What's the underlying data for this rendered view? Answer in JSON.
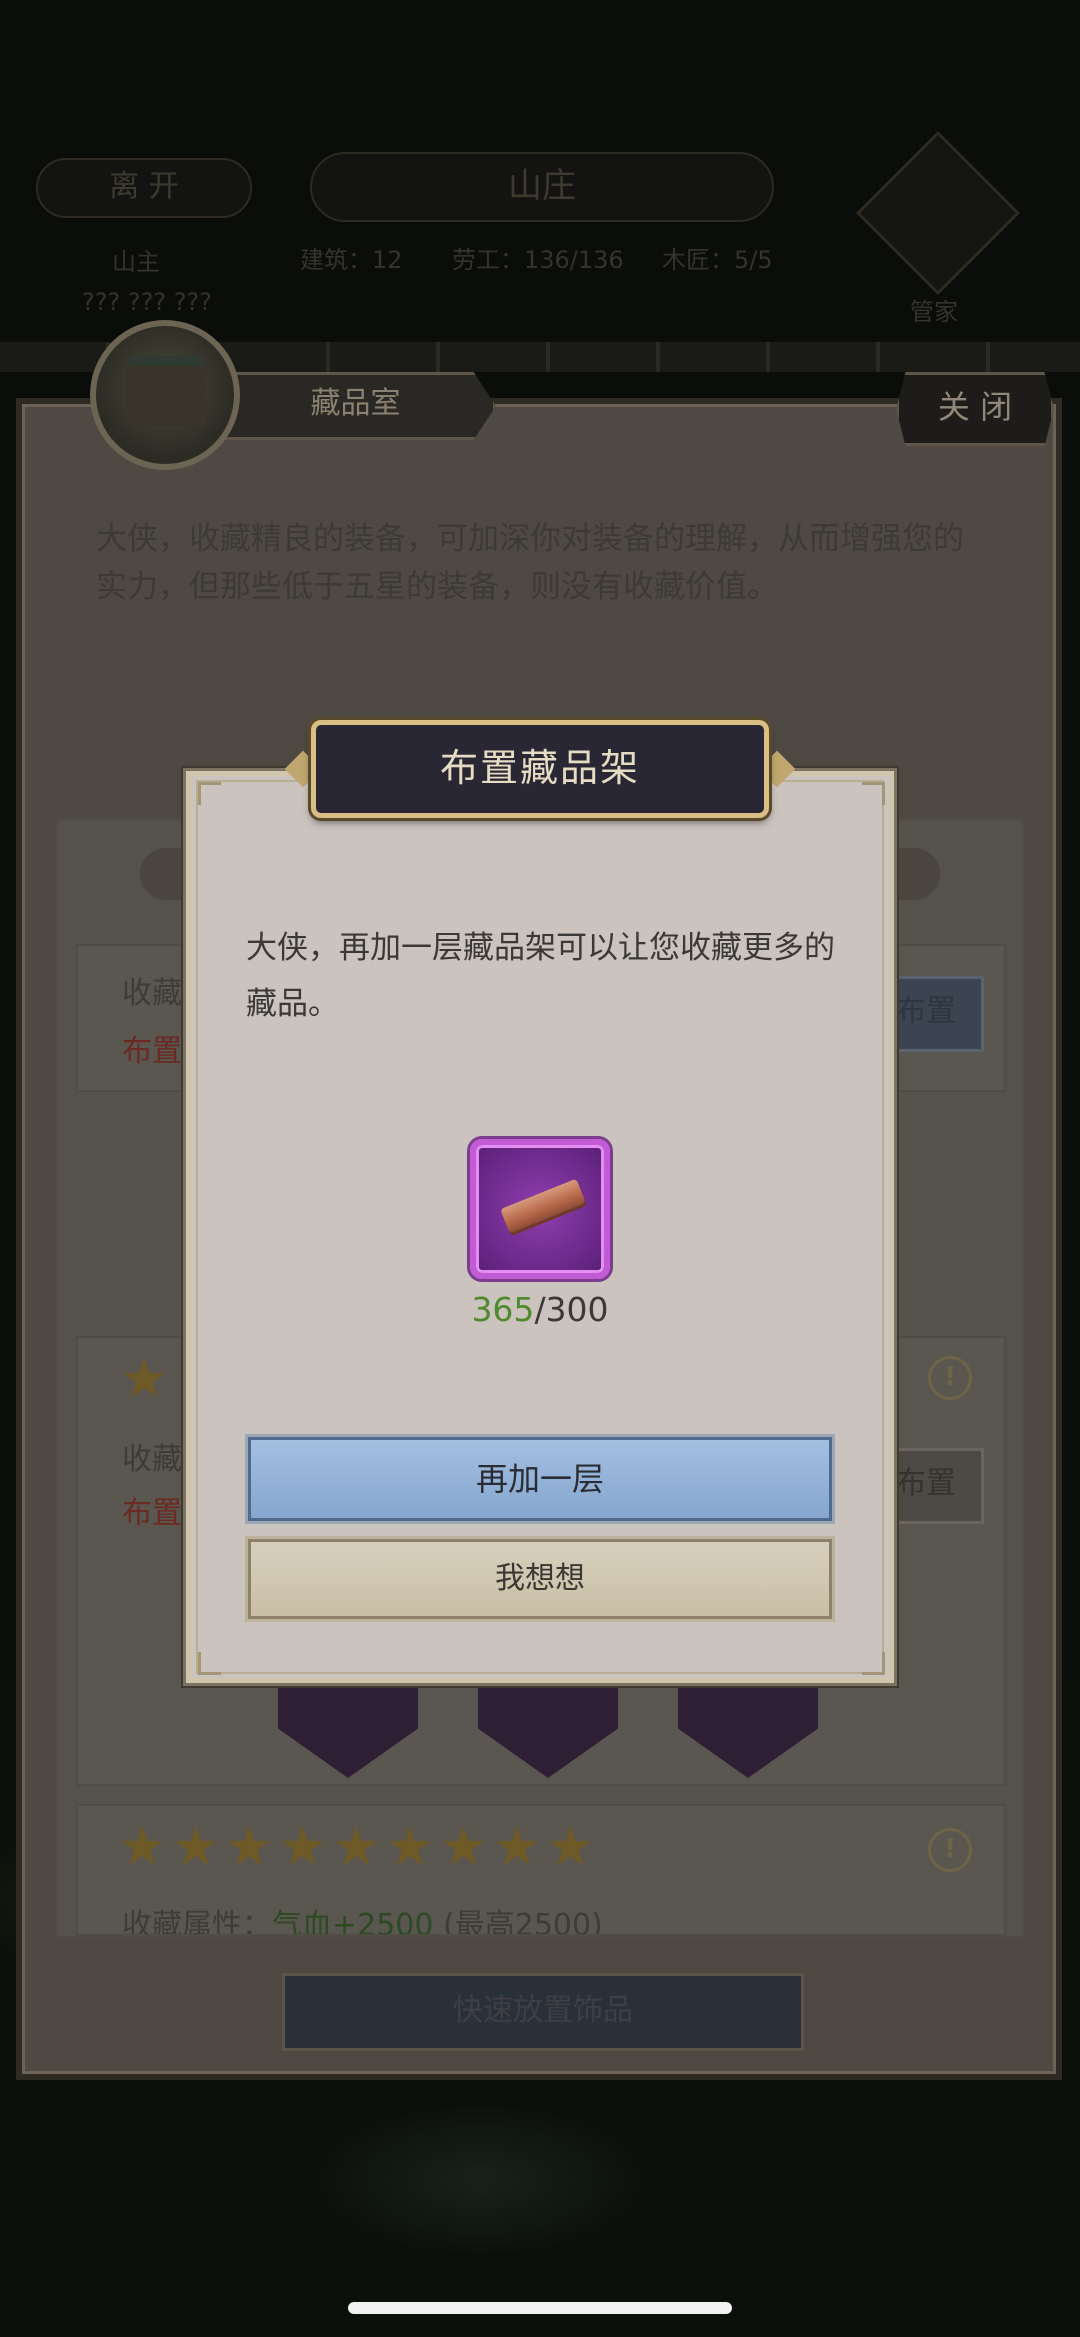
{
  "top_bar": {
    "leave_label": "离 开",
    "location_title": "山庄",
    "stats": [
      {
        "label": "建筑：",
        "value": "12"
      },
      {
        "label": "劳工：",
        "value": "136/136"
      },
      {
        "label": "木匠：",
        "value": "5/5"
      }
    ],
    "owner_line1": "山主",
    "owner_line2": "???  ???  ???",
    "steward_label": "管家"
  },
  "panel": {
    "title": "藏品室",
    "close_label": "关 闭",
    "description": "大侠，收藏精良的装备，可加深你对装备的理解，从而增强您的实力，但那些低于五星的装备，则没有收藏价值。",
    "cards": [
      {
        "label": "收藏属性",
        "sub": "布置需要",
        "action": "布置"
      },
      {
        "label": "收藏属性",
        "sub": "布置需要",
        "action": "布置",
        "stars": 1
      },
      {
        "label": "收藏属性：",
        "bonus": "气血+2500",
        "max": "(最高2500)",
        "stars": 9
      }
    ],
    "quick_place_label": "快速放置饰品"
  },
  "dialog": {
    "title": "布置藏品架",
    "message": "大侠，再加一层藏品架可以让您收藏更多的藏品。",
    "item_icon": "wood-plank-icon",
    "have_count": "365",
    "need_count": "/300",
    "confirm_label": "再加一层",
    "cancel_label": "我想想"
  },
  "colors": {
    "accent_gold": "#d9bf86",
    "item_rarity_purple": "#c15bd6",
    "count_ok_green": "#4f8a2f",
    "primary_button_blue": "#86a6cf"
  }
}
